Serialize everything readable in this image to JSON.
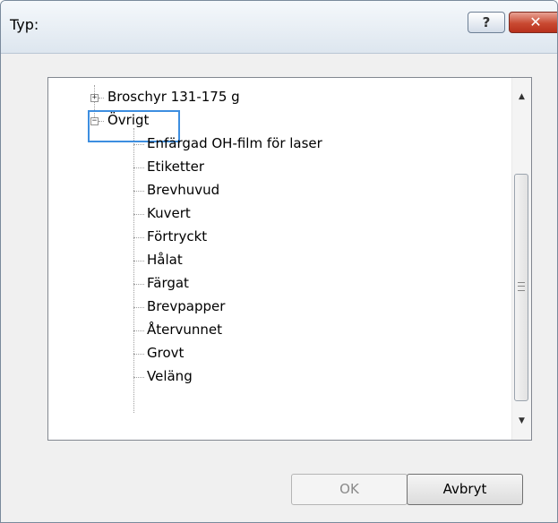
{
  "window": {
    "title": "Typ:",
    "help_label": "?",
    "close_label": "✕"
  },
  "tree": {
    "items": [
      {
        "label": "Broschyr 131-175 g",
        "level": 0,
        "expander": "+"
      },
      {
        "label": "Övrigt",
        "level": 0,
        "expander": "−"
      },
      {
        "label": "Enfärgad OH-film för laser",
        "level": 1
      },
      {
        "label": "Etiketter",
        "level": 1
      },
      {
        "label": "Brevhuvud",
        "level": 1
      },
      {
        "label": "Kuvert",
        "level": 1
      },
      {
        "label": "Förtryckt",
        "level": 1
      },
      {
        "label": "Hålat",
        "level": 1
      },
      {
        "label": "Färgat",
        "level": 1
      },
      {
        "label": "Brevpapper",
        "level": 1
      },
      {
        "label": "Återvunnet",
        "level": 1
      },
      {
        "label": "Grovt",
        "level": 1
      },
      {
        "label": "Veläng",
        "level": 1
      }
    ],
    "selected": "Övrigt"
  },
  "scrollbar": {
    "up_arrow": "▲",
    "down_arrow": "▼",
    "grip": "≡"
  },
  "buttons": {
    "ok_label": "OK",
    "ok_enabled": false,
    "cancel_label": "Avbryt"
  },
  "icons": {
    "expand": "plus-box-icon",
    "collapse": "minus-box-icon"
  }
}
